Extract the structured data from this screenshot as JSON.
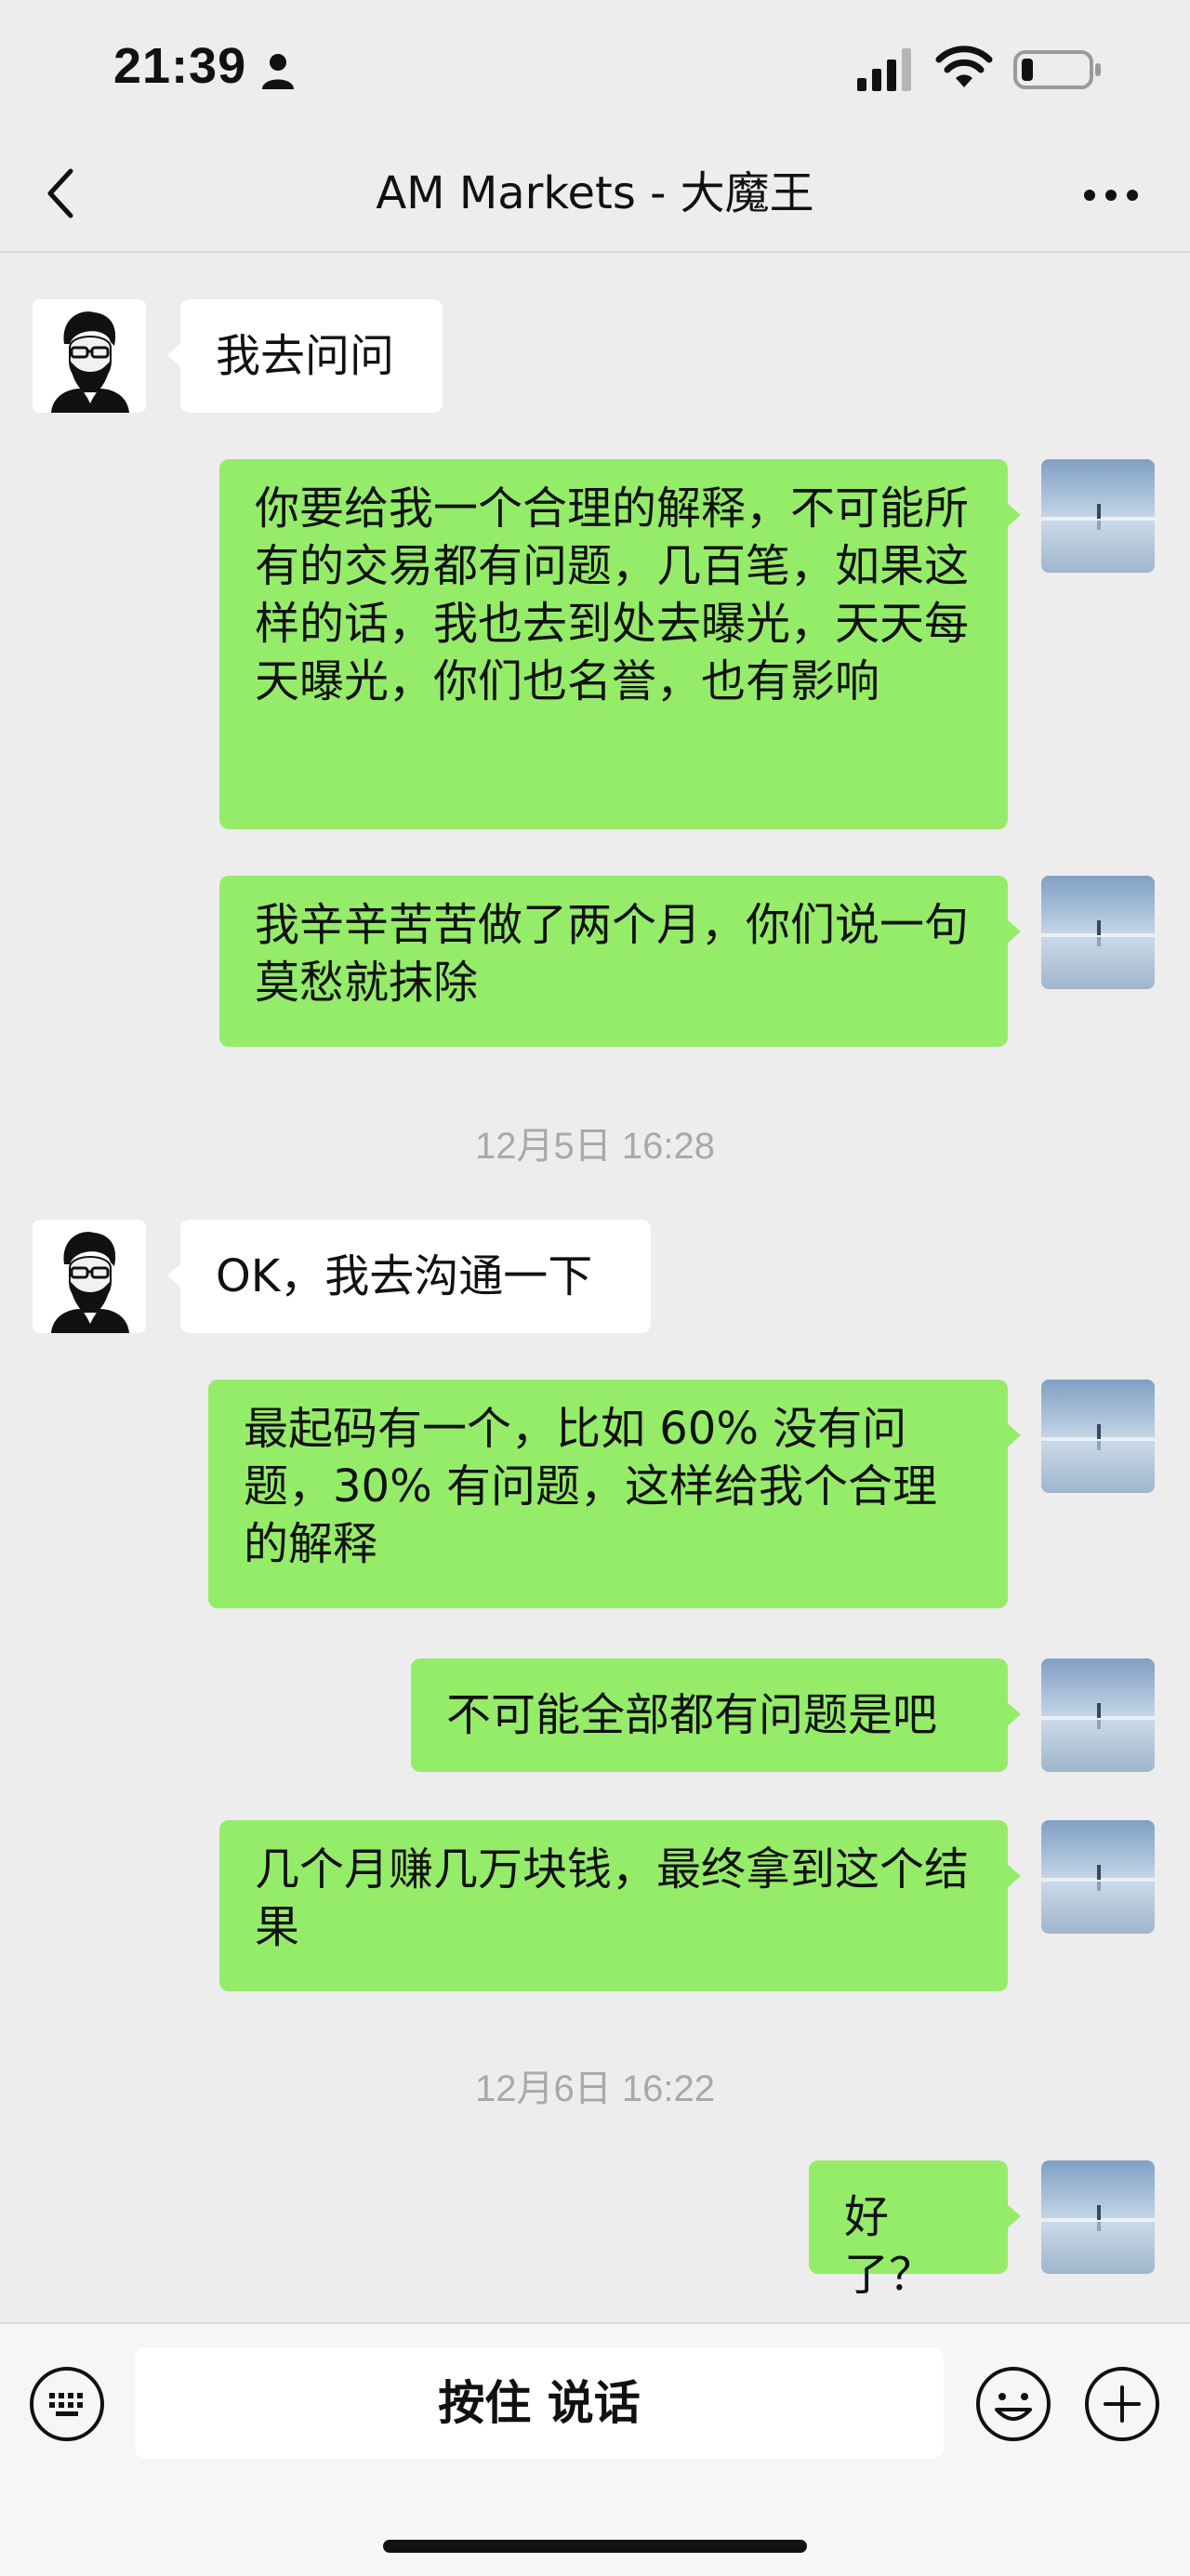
{
  "status_bar": {
    "time": "21:39",
    "icons": [
      "person-icon",
      "signal-icon",
      "wifi-icon",
      "battery-icon"
    ]
  },
  "nav": {
    "title": "AM Markets - 大魔王",
    "back_icon": "chevron-left-icon",
    "more_icon": "more-dots-icon"
  },
  "messages": [
    {
      "side": "left",
      "text": "我去问问"
    },
    {
      "side": "right",
      "text": "你要给我一个合理的解释，不可能所有的交易都有问题，几百笔，如果这样的话，我也去到处去曝光，天天每天曝光，你们也名誉，也有影响"
    },
    {
      "side": "right",
      "text": "我辛辛苦苦做了两个月，你们说一句莫愁就抹除"
    },
    {
      "timestamp": "12月5日 16:28"
    },
    {
      "side": "left",
      "text": "OK，我去沟通一下"
    },
    {
      "side": "right",
      "text": "最起码有一个，比如 60% 没有问题，30% 有问题，这样给我个合理的解释"
    },
    {
      "side": "right",
      "text": "不可能全部都有问题是吧"
    },
    {
      "side": "right",
      "text": "几个月赚几万块钱，最终拿到这个结果"
    },
    {
      "timestamp": "12月6日 16:22"
    },
    {
      "side": "right",
      "text": "好了？"
    }
  ],
  "input_bar": {
    "voice_label": "按住 说话",
    "icons": [
      "keyboard-icon",
      "emoji-icon",
      "plus-icon"
    ]
  },
  "colors": {
    "background": "#ededed",
    "sent_bubble": "#95ec69",
    "received_bubble": "#ffffff",
    "timestamp_text": "#a9a9a9"
  }
}
